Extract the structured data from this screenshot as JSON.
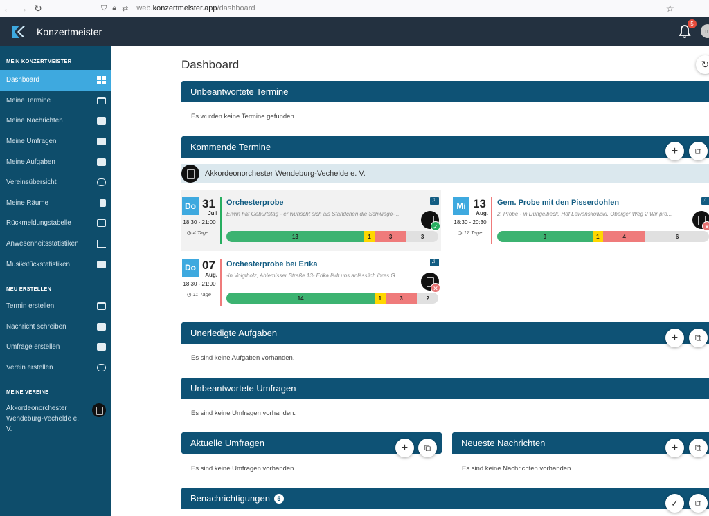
{
  "browser": {
    "url_host": "web.",
    "url_domain": "konzertmeister.app",
    "url_path": "/dashboard"
  },
  "header": {
    "title": "Konzertmeister",
    "notification_count": "5",
    "avatar_initial": "m"
  },
  "sidebar": {
    "section_mine": "MEIN KONZERTMEISTER",
    "items": [
      {
        "label": "Dashboard",
        "icon": "dashboard-icon"
      },
      {
        "label": "Meine Termine",
        "icon": "calendar-icon"
      },
      {
        "label": "Meine Nachrichten",
        "icon": "message-icon"
      },
      {
        "label": "Meine Umfragen",
        "icon": "poll-icon"
      },
      {
        "label": "Meine Aufgaben",
        "icon": "task-icon"
      },
      {
        "label": "Vereinsübersicht",
        "icon": "lyre-icon"
      },
      {
        "label": "Meine Räume",
        "icon": "room-icon"
      },
      {
        "label": "Rückmeldungstabelle",
        "icon": "table-icon"
      },
      {
        "label": "Anwesenheitsstatistiken",
        "icon": "bar-chart-icon"
      },
      {
        "label": "Musikstückstatistiken",
        "icon": "music-stats-icon"
      }
    ],
    "section_new": "NEU ERSTELLEN",
    "new_items": [
      {
        "label": "Termin erstellen",
        "icon": "calendar-icon"
      },
      {
        "label": "Nachricht schreiben",
        "icon": "message-icon"
      },
      {
        "label": "Umfrage erstellen",
        "icon": "poll-icon"
      },
      {
        "label": "Verein erstellen",
        "icon": "lyre-icon"
      }
    ],
    "section_clubs": "MEINE VEREINE",
    "club": "Akkordeonorchester Wendeburg-Vechelde e. V."
  },
  "main": {
    "title": "Dashboard",
    "unanswered_events": {
      "title": "Unbeantwortete Termine",
      "empty": "Es wurden keine Termine gefunden."
    },
    "upcoming_events": {
      "title": "Kommende Termine",
      "club": "Akkordeonorchester Wendeburg-Vechelde e. V."
    },
    "events": [
      {
        "weekday": "Do",
        "day": "31",
        "month": "Juli",
        "time": "18:30 - 21:00",
        "days_left": "4 Tage",
        "title": "Orchesterprobe",
        "desc": "Erwin hat Geburtstag - er wünscht sich als Ständchen die Schwiago-...",
        "status": "ok",
        "status_icon": "check-icon",
        "line_color": "#27ae60",
        "counts": {
          "yes": "13",
          "maybe": "1",
          "no": "3",
          "none": "3"
        }
      },
      {
        "weekday": "Mi",
        "day": "13",
        "month": "Aug.",
        "time": "18:30 - 20:30",
        "days_left": "17 Tage",
        "title": "Gem. Probe mit den Pisserdohlen",
        "desc": "2. Probe - in Dungelbeck. Hof Lewanskowski. Oberger Weg 2 Wir pro...",
        "status": "no",
        "status_icon": "cross-icon",
        "line_color": "#ef7b7b",
        "counts": {
          "yes": "9",
          "maybe": "1",
          "no": "4",
          "none": "6"
        }
      },
      {
        "weekday": "Do",
        "day": "07",
        "month": "Aug.",
        "time": "18:30 - 21:00",
        "days_left": "11 Tage",
        "title": "Orchesterprobe bei Erika",
        "desc": "-in Voigtholz, Ahlemisser Straße 13- Erika lädt uns anlässlich ihres G...",
        "status": "no",
        "status_icon": "cross-icon",
        "line_color": "#ef7b7b",
        "counts": {
          "yes": "14",
          "maybe": "1",
          "no": "3",
          "none": "2"
        }
      }
    ],
    "open_tasks": {
      "title": "Unerledigte Aufgaben",
      "empty": "Es sind keine Aufgaben vorhanden."
    },
    "unanswered_polls": {
      "title": "Unbeantwortete Umfragen",
      "empty": "Es sind keine Umfragen vorhanden."
    },
    "current_polls": {
      "title": "Aktuelle Umfragen",
      "empty": "Es sind keine Umfragen vorhanden."
    },
    "latest_messages": {
      "title": "Neueste Nachrichten",
      "empty": "Es sind keine Nachrichten vorhanden."
    },
    "notifications": {
      "title": "Benachrichtigungen",
      "count": "5"
    }
  },
  "colors": {
    "sidebar": "#0e4d6b",
    "header": "#233140",
    "section_bar": "#0e5275",
    "accent": "#3ea9df"
  }
}
